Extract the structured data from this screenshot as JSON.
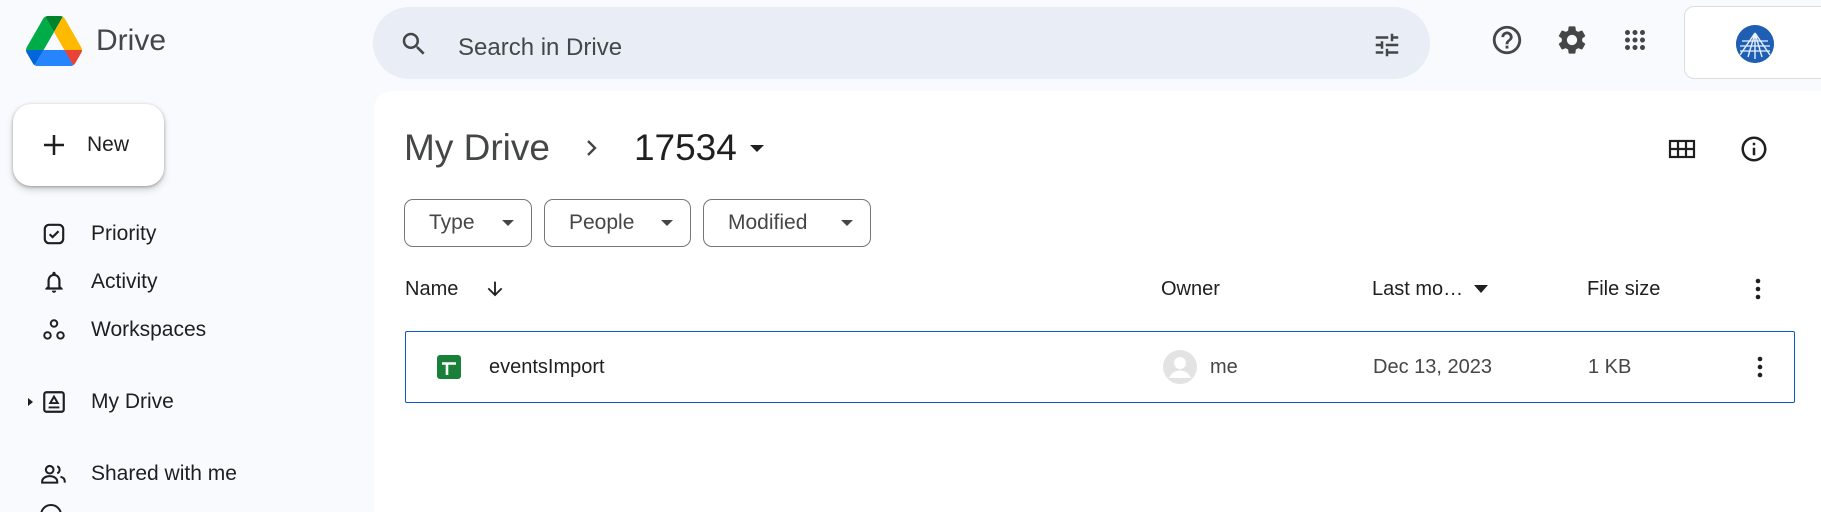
{
  "app": {
    "name": "Drive",
    "search_placeholder": "Search in Drive"
  },
  "header": {
    "icons": [
      "help-icon",
      "settings-icon",
      "apps-icon"
    ]
  },
  "sidebar": {
    "new_label": "New",
    "items": [
      {
        "label": "Priority",
        "icon": "priority-icon"
      },
      {
        "label": "Activity",
        "icon": "bell-icon"
      },
      {
        "label": "Workspaces",
        "icon": "workspaces-icon"
      },
      {
        "label": "My Drive",
        "icon": "my-drive-icon"
      },
      {
        "label": "Shared with me",
        "icon": "shared-icon"
      }
    ]
  },
  "breadcrumb": {
    "root": "My Drive",
    "current": "17534"
  },
  "filters": {
    "type": "Type",
    "people": "People",
    "modified": "Modified"
  },
  "table": {
    "columns": {
      "name": "Name",
      "owner": "Owner",
      "modified": "Last mo…",
      "size": "File size"
    },
    "rows": [
      {
        "name": "eventsImport",
        "owner": "me",
        "modified": "Dec 13, 2023",
        "size": "1 KB",
        "icon": "sheets-icon"
      }
    ]
  },
  "colors": {
    "selection_border": "#0b57d0",
    "sheets_green": "#188038",
    "search_bg": "#e9eef6",
    "page_bg": "#f8fafd"
  }
}
